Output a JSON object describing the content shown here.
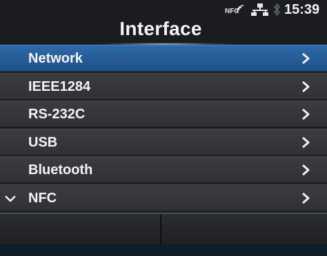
{
  "status_bar": {
    "nfc_label": "NFC",
    "time": "15:39",
    "icons": [
      "nfc-icon",
      "network-icon",
      "bluetooth-icon"
    ]
  },
  "title": "Interface",
  "menu": {
    "items": [
      {
        "label": "Network",
        "selected": true
      },
      {
        "label": "IEEE1284",
        "selected": false
      },
      {
        "label": "RS-232C",
        "selected": false
      },
      {
        "label": "USB",
        "selected": false
      },
      {
        "label": "Bluetooth",
        "selected": false
      },
      {
        "label": "NFC",
        "selected": false
      }
    ],
    "more_indicator": "chevron-down-icon"
  },
  "colors": {
    "selected_row": "#2b66a4",
    "row": "#35373a",
    "text": "#f4f4f4"
  }
}
